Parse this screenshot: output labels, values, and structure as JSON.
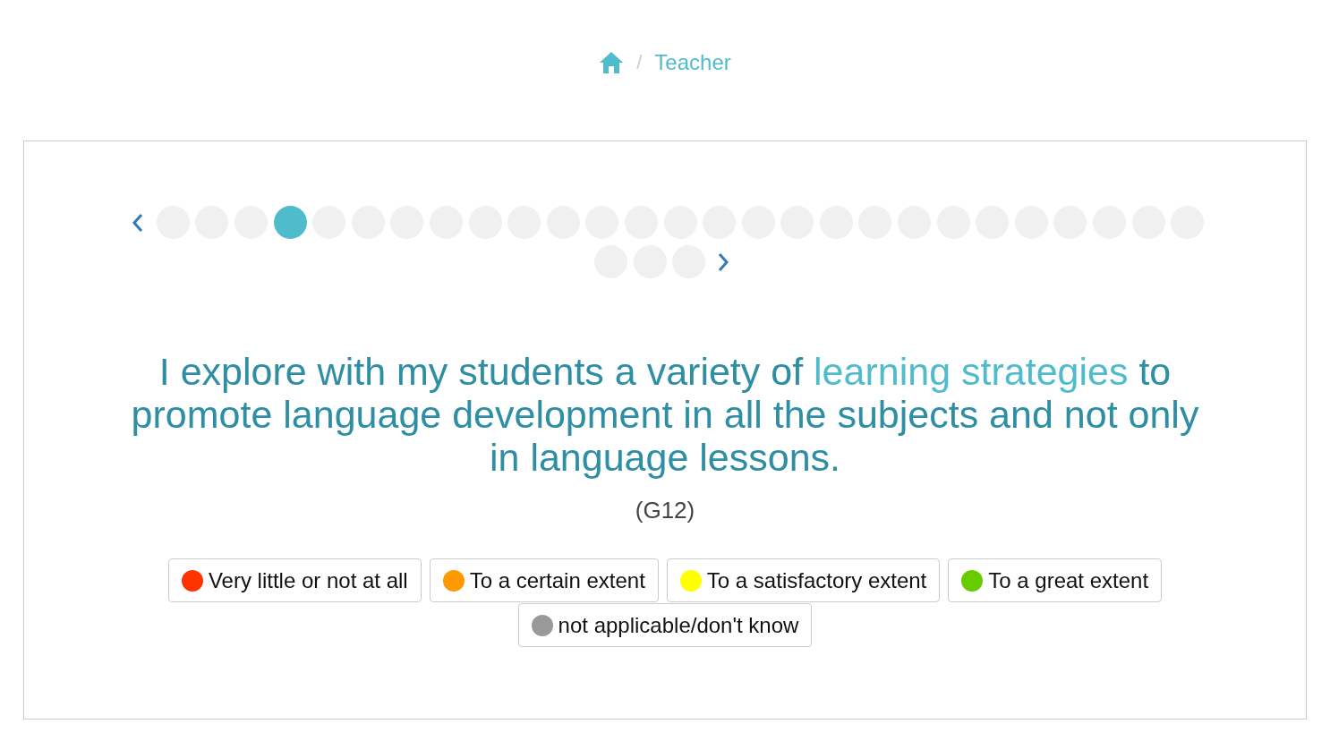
{
  "breadcrumb": {
    "current": "Teacher",
    "separator": "/"
  },
  "pager": {
    "dots": [
      {
        "selected": false
      },
      {
        "selected": false
      },
      {
        "selected": false
      },
      {
        "selected": true
      },
      {
        "selected": false
      },
      {
        "selected": false
      },
      {
        "selected": false
      },
      {
        "selected": false
      },
      {
        "selected": false
      },
      {
        "selected": false
      },
      {
        "selected": false
      },
      {
        "selected": false
      },
      {
        "selected": false
      },
      {
        "selected": false
      },
      {
        "selected": false
      },
      {
        "selected": false
      },
      {
        "selected": false
      },
      {
        "selected": false
      },
      {
        "selected": false
      },
      {
        "selected": false
      },
      {
        "selected": false
      },
      {
        "selected": false
      },
      {
        "selected": false
      },
      {
        "selected": false
      },
      {
        "selected": false
      },
      {
        "selected": false
      },
      {
        "selected": false
      },
      {
        "selected": false
      },
      {
        "selected": false
      },
      {
        "selected": false
      }
    ]
  },
  "question": {
    "parts": [
      {
        "text": "I explore with my students a variety of ",
        "highlighted": false
      },
      {
        "text": "learning strategies",
        "highlighted": true
      },
      {
        "text": " to promote language development in all the subjects and not only in language lessons.",
        "highlighted": false
      }
    ],
    "code": "(G12)"
  },
  "options": [
    {
      "label": "Very little or not at all",
      "color": "#ff3300"
    },
    {
      "label": "To a certain extent",
      "color": "#ff9900"
    },
    {
      "label": "To a satisfactory extent",
      "color": "#ffff00"
    },
    {
      "label": "To a great extent",
      "color": "#66cc00"
    },
    {
      "label": "not applicable/don't know",
      "color": "#999999"
    }
  ]
}
